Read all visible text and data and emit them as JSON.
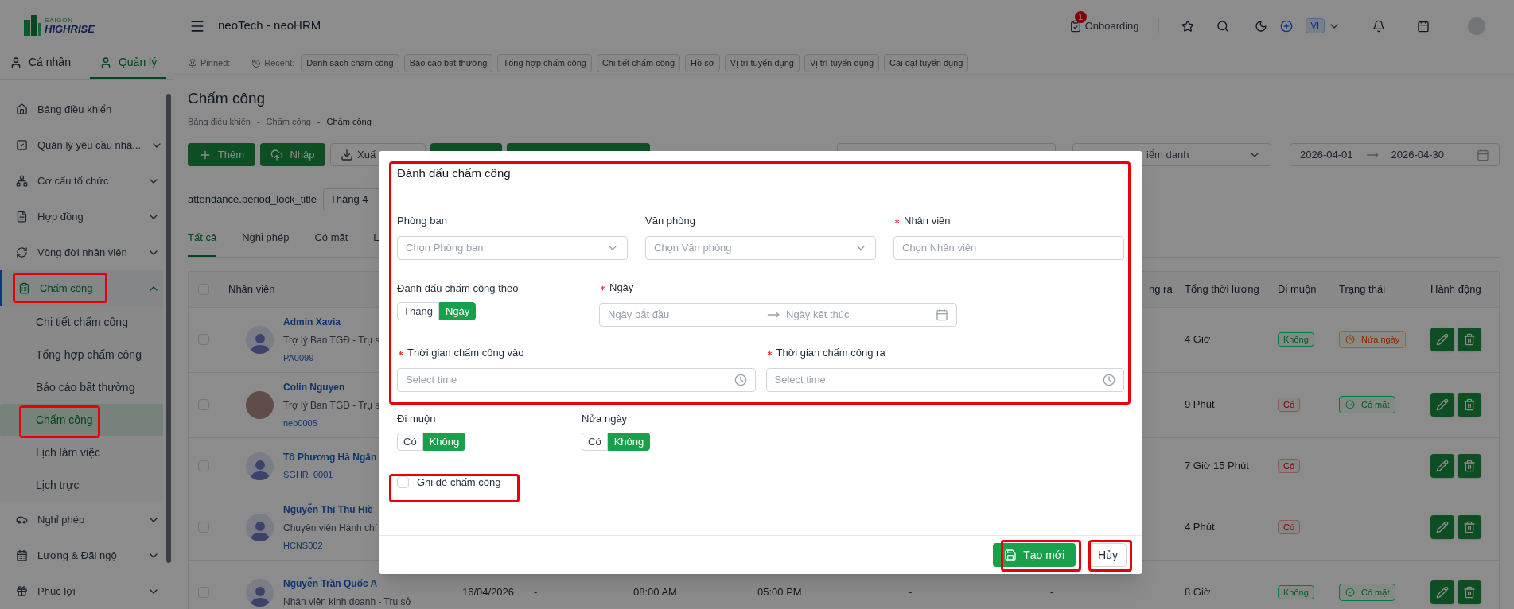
{
  "logo": {
    "line1": "SAIGON",
    "line2": "HIGHRISE"
  },
  "sidebar": {
    "tabs": [
      {
        "label": "Cá nhân",
        "selected": false
      },
      {
        "label": "Quản lý",
        "selected": true
      }
    ],
    "items": [
      {
        "label": "Bảng điều khiển",
        "kind": "link",
        "selected": false
      },
      {
        "label": "Quản lý yêu cầu nhâ...",
        "kind": "group",
        "expanded": false,
        "selected": false
      },
      {
        "label": "Cơ cấu tổ chức",
        "kind": "group",
        "expanded": false,
        "selected": false
      },
      {
        "label": "Hợp đồng",
        "kind": "group",
        "expanded": false,
        "selected": false
      },
      {
        "label": "Vòng đời nhân viên",
        "kind": "group",
        "expanded": false,
        "selected": false
      },
      {
        "label": "Chấm công",
        "kind": "group",
        "expanded": true,
        "selected": true,
        "children": [
          {
            "label": "Chi tiết chấm công",
            "selected": false
          },
          {
            "label": "Tổng hợp chấm công",
            "selected": false
          },
          {
            "label": "Báo cáo bất thường",
            "selected": false
          },
          {
            "label": "Chấm công",
            "selected": true
          },
          {
            "label": "Lịch làm việc",
            "selected": false
          },
          {
            "label": "Lịch trực",
            "selected": false
          }
        ]
      },
      {
        "label": "Nghỉ phép",
        "kind": "group",
        "expanded": false,
        "selected": false
      },
      {
        "label": "Lương & Đãi ngộ",
        "kind": "group",
        "expanded": false,
        "selected": false
      },
      {
        "label": "Phúc lợi",
        "kind": "group",
        "expanded": false,
        "selected": false
      }
    ]
  },
  "topbar": {
    "title": "neoTech - neoHRM",
    "onboarding": {
      "label": "Onboarding",
      "badge": "1"
    },
    "language": "VI"
  },
  "quickbar": {
    "pinned_label": "Pinned:",
    "pinned_value": "---",
    "recent_label": "Recent:",
    "recent": [
      "Danh sách chấm công",
      "Báo cáo bất thường",
      "Tổng hợp chấm công",
      "Chi tiết chấm công",
      "Hồ sơ",
      "Vị trí tuyển dụng",
      "Vị trí tuyển dụng",
      "Cài đặt tuyển dụng"
    ]
  },
  "page": {
    "title": "Chấm công",
    "breadcrumb": {
      "items": [
        "Bảng điều khiển",
        "Chấm công",
        "Chấm công"
      ],
      "separators": [
        "-",
        "-"
      ]
    },
    "toolbar": [
      {
        "label": "Thêm",
        "kind": "add"
      },
      {
        "label": "Nhập",
        "kind": "import"
      },
      {
        "label": "Xuấ",
        "kind": "export"
      },
      {
        "kind": "green"
      },
      {
        "kind": "green"
      }
    ],
    "filter_2": "iểm danh",
    "date_range": {
      "start": "2026-04-01",
      "end": "2026-04-30"
    },
    "period_lock": {
      "label": "attendance.period_lock_title",
      "value": "Tháng 4"
    },
    "tabs": [
      {
        "label": "Tất cả",
        "selected": true
      },
      {
        "label": "Nghỉ phép",
        "selected": false
      },
      {
        "label": "Có mặt",
        "selected": false
      },
      {
        "label": "L",
        "selected": false
      }
    ]
  },
  "table": {
    "header_checked": false,
    "columns": {
      "employee": "Nhân viên",
      "column_8": "ng ra",
      "total": "Tổng thời lượng",
      "late": "Đi muộn",
      "status": "Trạng thái",
      "actions": "Hành động"
    },
    "rows": [
      {
        "name": "Admin Xavia",
        "position": "Trợ lý Ban TGĐ - Trụ s",
        "code": "PA0099",
        "avatar": {
          "kind": "default"
        },
        "checked": false,
        "total": "4 Giờ",
        "late": {
          "text": "Không",
          "kind": "no"
        },
        "status": {
          "text": "Nửa ngày",
          "kind": "half"
        }
      },
      {
        "name": "Colin Nguyen",
        "position": "Trợ lý Ban TGĐ - Trụ s",
        "code": "neo0005",
        "avatar": {
          "kind": "photo"
        },
        "checked": false,
        "total": "9 Phút",
        "late": {
          "text": "Có",
          "kind": "yes"
        },
        "status": {
          "text": "Có mặt",
          "kind": "present"
        }
      },
      {
        "name": "Tô Phương Hà Ngân",
        "code": "SGHR_0001",
        "avatar": {
          "kind": "default"
        },
        "checked": false,
        "total": "7 Giờ 15 Phút",
        "late": {
          "text": "Có",
          "kind": "yes"
        }
      },
      {
        "name": "Nguyễn Thị Thu Hiề",
        "position": "Chuyên viên Hành chí",
        "code": "HCNS002",
        "avatar": {
          "kind": "default"
        },
        "checked": false,
        "total": "4 Phút",
        "late": {
          "text": "Có",
          "kind": "yes"
        }
      },
      {
        "name": "Nguyễn Trần Quốc A",
        "position": "Nhân viên kinh doanh - Trụ sở",
        "avatar": {
          "kind": "default"
        },
        "checked": false,
        "cells": [
          "16/04/2026",
          "-",
          "08:00 AM",
          "05:00 PM",
          "-",
          "-"
        ],
        "total": "8 Giờ",
        "late": {
          "text": "Không",
          "kind": "no"
        },
        "status": {
          "text": "Có mặt",
          "kind": "present"
        }
      }
    ]
  },
  "modal": {
    "title": "Đánh dấu chấm công",
    "fields": [
      {
        "label": "Phòng ban",
        "placeholder": "Chọn Phòng ban",
        "required": false,
        "kind": "select"
      },
      {
        "label": "Văn phòng",
        "placeholder": "Chọn Văn phòng",
        "required": false,
        "kind": "select"
      },
      {
        "label": "Nhân viên",
        "placeholder": "Chọn Nhân viên",
        "required": true,
        "kind": "input"
      }
    ],
    "mark_by": {
      "label": "Đánh dấu chấm công theo",
      "options": [
        {
          "label": "Tháng",
          "selected": false
        },
        {
          "label": "Ngày",
          "selected": true
        }
      ]
    },
    "date": {
      "label": "Ngày",
      "required": true,
      "start_placeholder": "Ngày bắt đầu",
      "end_placeholder": "Ngày kết thúc"
    },
    "times": [
      {
        "label": "Thời gian chấm công vào",
        "required": true,
        "placeholder": "Select time"
      },
      {
        "label": "Thời gian chấm công ra",
        "required": true,
        "placeholder": "Select time"
      }
    ],
    "toggles": [
      {
        "label": "Đi muộn",
        "options": [
          {
            "label": "Có",
            "selected": false
          },
          {
            "label": "Không",
            "selected": true
          }
        ]
      },
      {
        "label": "Nửa ngày",
        "options": [
          {
            "label": "Có",
            "selected": false
          },
          {
            "label": "Không",
            "selected": true
          }
        ]
      }
    ],
    "override": {
      "label": "Ghi đè chấm công",
      "checked": false
    },
    "buttons": [
      {
        "label": "Tạo mới",
        "kind": "primary"
      },
      {
        "label": "Hủy",
        "kind": "default"
      }
    ]
  }
}
